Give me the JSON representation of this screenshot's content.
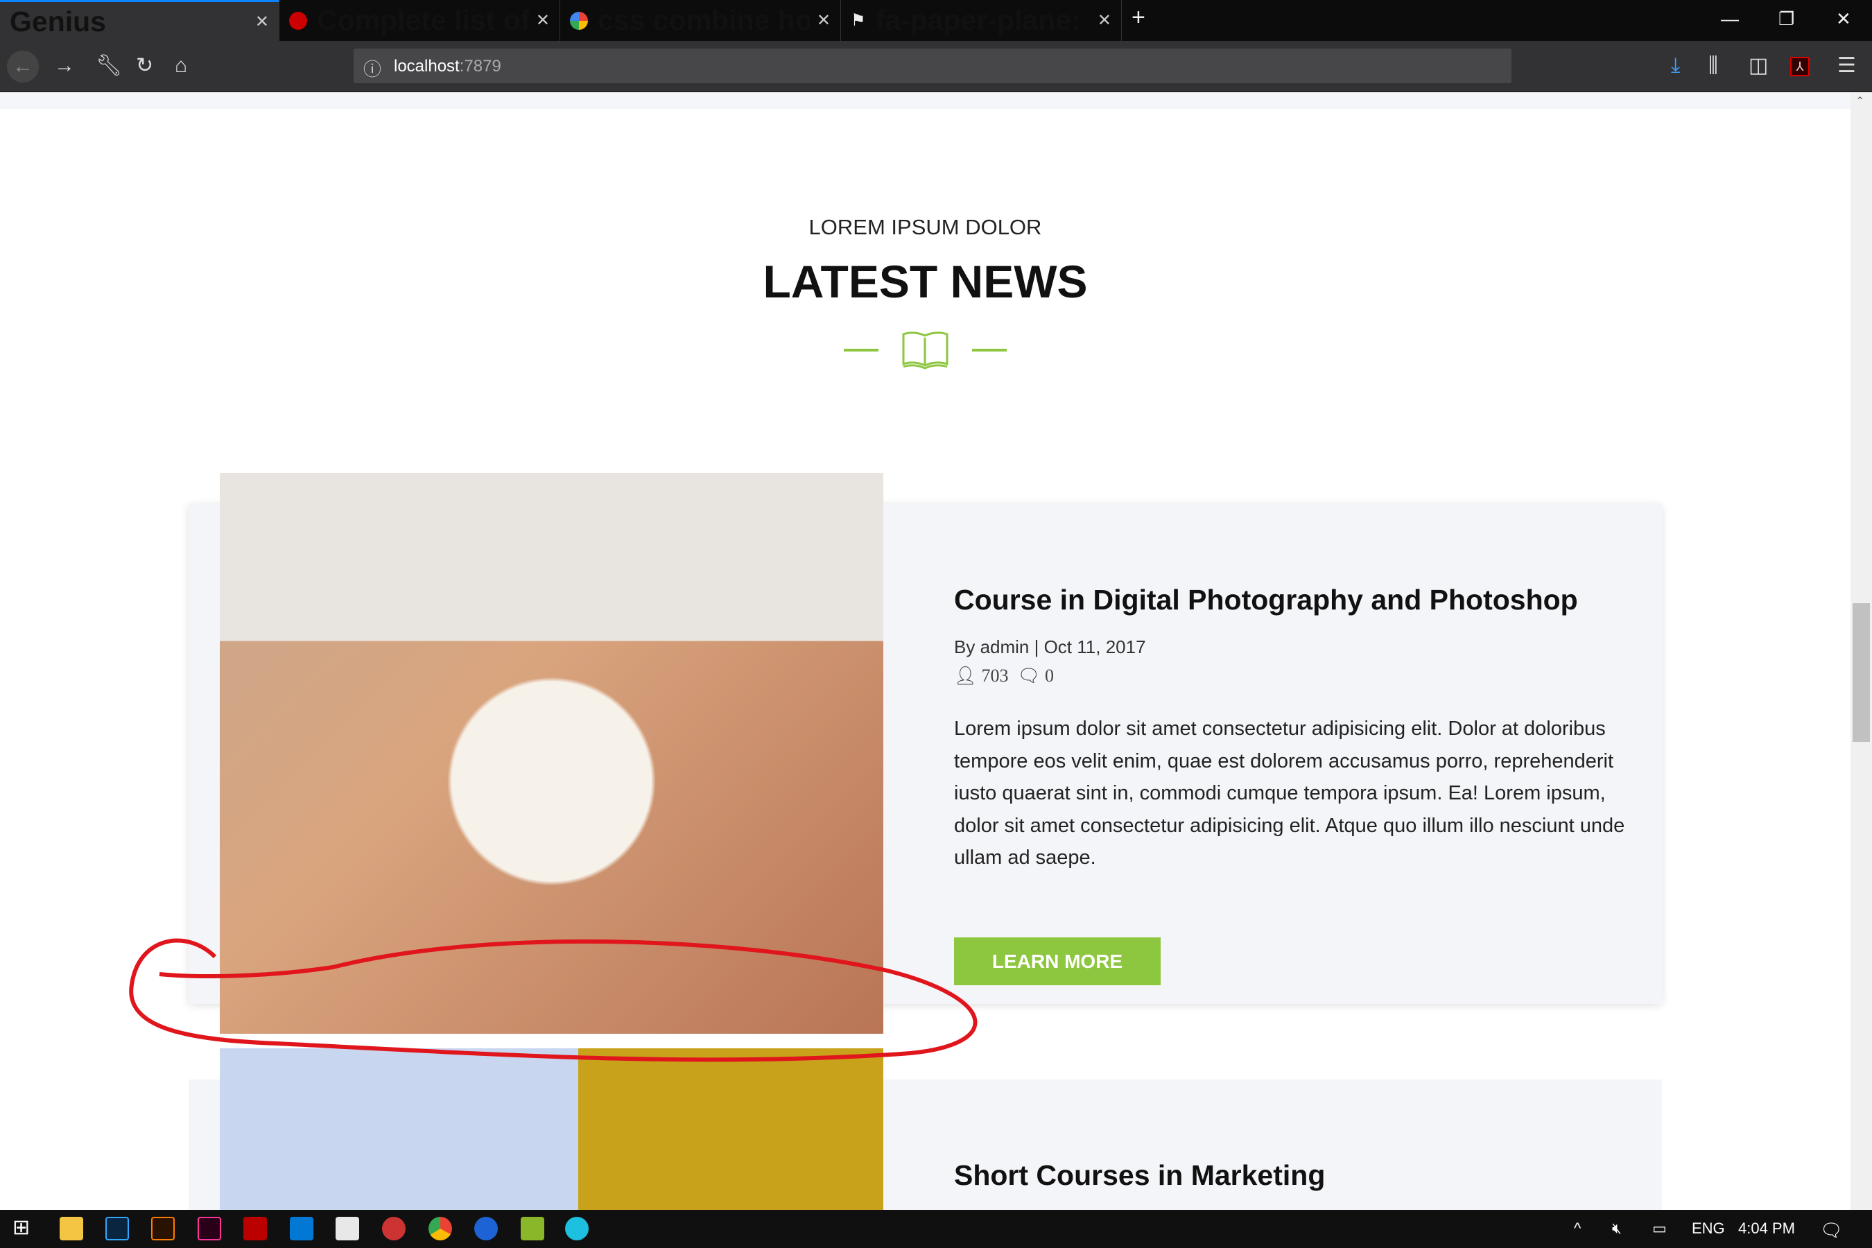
{
  "browser": {
    "tabs": [
      {
        "title": "Genius",
        "active": true
      },
      {
        "title": "Complete list of Font Awesome",
        "favicon": "red-circle-icon"
      },
      {
        "title": "css combine hover and before",
        "favicon": "google-icon"
      },
      {
        "title": "fa-paper-plane: Font Awesome",
        "favicon": "flag-icon"
      }
    ],
    "url_host": "localhost",
    "url_port": ":7879"
  },
  "page": {
    "kicker": "LOREM IPSUM DOLOR",
    "heading": "LATEST NEWS",
    "accent": "#8dc63f",
    "posts": [
      {
        "title": "Course in Digital Photography and Photoshop",
        "meta": "By admin | Oct 11, 2017",
        "views": "703",
        "comments": "0",
        "body": "Lorem ipsum dolor sit amet consectetur adipisicing elit. Dolor at doloribus tempore eos velit enim, quae est dolorem accusamus porro, reprehenderit iusto quaerat sint in, commodi cumque tempora ipsum. Ea! Lorem ipsum, dolor sit amet consectetur adipisicing elit. Atque quo illum illo nesciunt unde ullam ad saepe.",
        "button": "LEARN MORE"
      },
      {
        "title": "Short Courses in Marketing"
      }
    ]
  },
  "annotation_color": "#e0161c",
  "taskbar": {
    "lang": "ENG",
    "time": "4:04 PM"
  }
}
